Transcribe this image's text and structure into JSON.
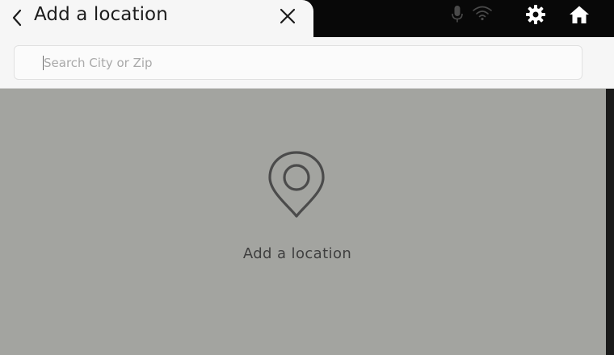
{
  "header": {
    "title": "Add a location",
    "back_icon": "chevron-left-icon",
    "close_icon": "close-icon"
  },
  "status_bar": {
    "icons": [
      "microphone-icon",
      "wifi-icon",
      "gear-icon",
      "home-icon"
    ]
  },
  "search": {
    "placeholder": "Search City or Zip",
    "value": ""
  },
  "empty_state": {
    "icon": "location-pin-icon",
    "label": "Add a location"
  },
  "colors": {
    "header_bg": "#f6f6f6",
    "status_bar_bg": "#080808",
    "content_bg": "#a3a4a0",
    "text_dark": "#1c1c1c",
    "placeholder": "#a9a9a9"
  }
}
